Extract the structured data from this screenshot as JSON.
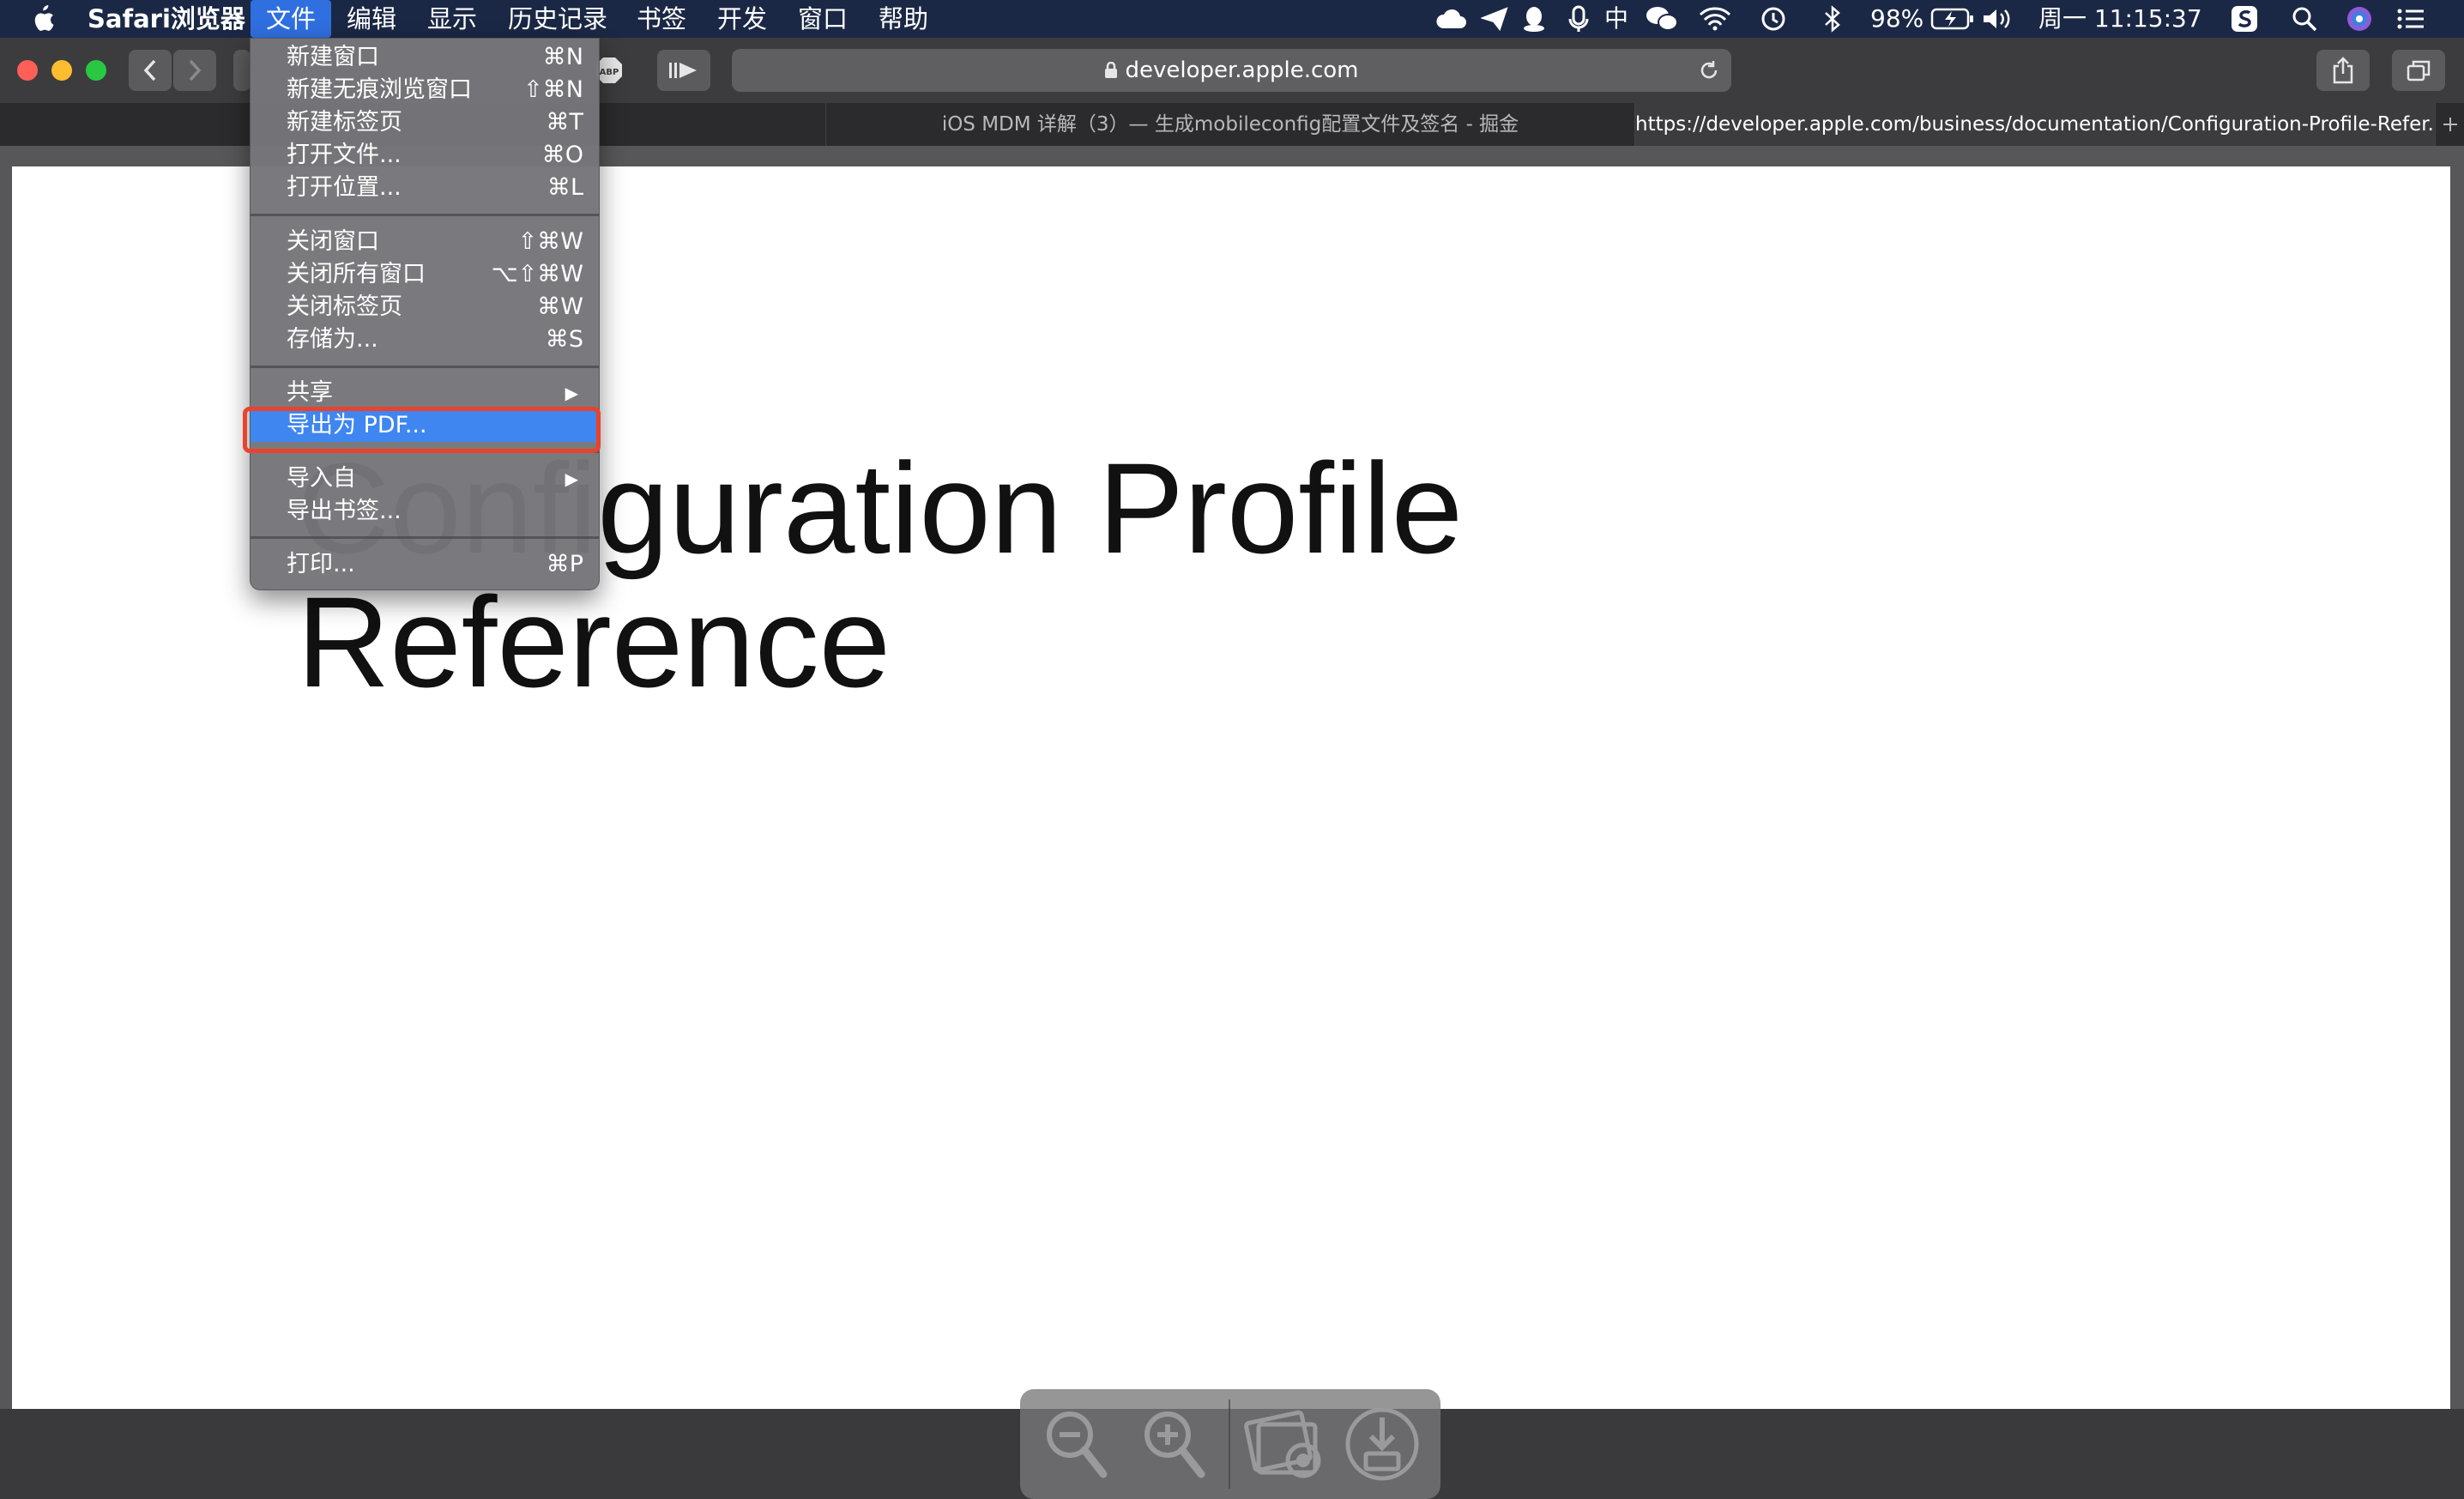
{
  "menubar": {
    "app_name": "Safari浏览器",
    "menus": [
      "文件",
      "编辑",
      "显示",
      "历史记录",
      "书签",
      "开发",
      "窗口",
      "帮助"
    ],
    "status": {
      "input_method": "中",
      "battery": "98%",
      "clock": "周一 11:15:37"
    }
  },
  "toolbar": {
    "url": "developer.apple.com"
  },
  "tabs": [
    {
      "title": "iOS MDM 详解（3）— 生成mobileconfig配置文件及签名 - 掘金",
      "active": false
    },
    {
      "title": "https://developer.apple.com/business/documentation/Configuration-Profile-Refer...",
      "active": true
    }
  ],
  "document": {
    "heading": "Configuration Profile\nReference"
  },
  "file_menu": {
    "groups": [
      [
        {
          "label": "新建窗口",
          "shortcut": "⌘N"
        },
        {
          "label": "新建无痕浏览窗口",
          "shortcut": "⇧⌘N"
        },
        {
          "label": "新建标签页",
          "shortcut": "⌘T"
        },
        {
          "label": "打开文件...",
          "shortcut": "⌘O"
        },
        {
          "label": "打开位置...",
          "shortcut": "⌘L"
        }
      ],
      [
        {
          "label": "关闭窗口",
          "shortcut": "⇧⌘W"
        },
        {
          "label": "关闭所有窗口",
          "shortcut": "⌥⇧⌘W"
        },
        {
          "label": "关闭标签页",
          "shortcut": "⌘W"
        },
        {
          "label": "存储为...",
          "shortcut": "⌘S"
        }
      ],
      [
        {
          "label": "共享",
          "submenu": true
        },
        {
          "label": "导出为 PDF...",
          "selected": true
        }
      ],
      [
        {
          "label": "导入自",
          "submenu": true
        },
        {
          "label": "导出书签..."
        }
      ],
      [
        {
          "label": "打印...",
          "shortcut": "⌘P"
        }
      ]
    ]
  },
  "colors": {
    "menubar_bg": "#1b2845",
    "menu_selected": "#3f86f0",
    "highlight_border": "#e8432e"
  }
}
